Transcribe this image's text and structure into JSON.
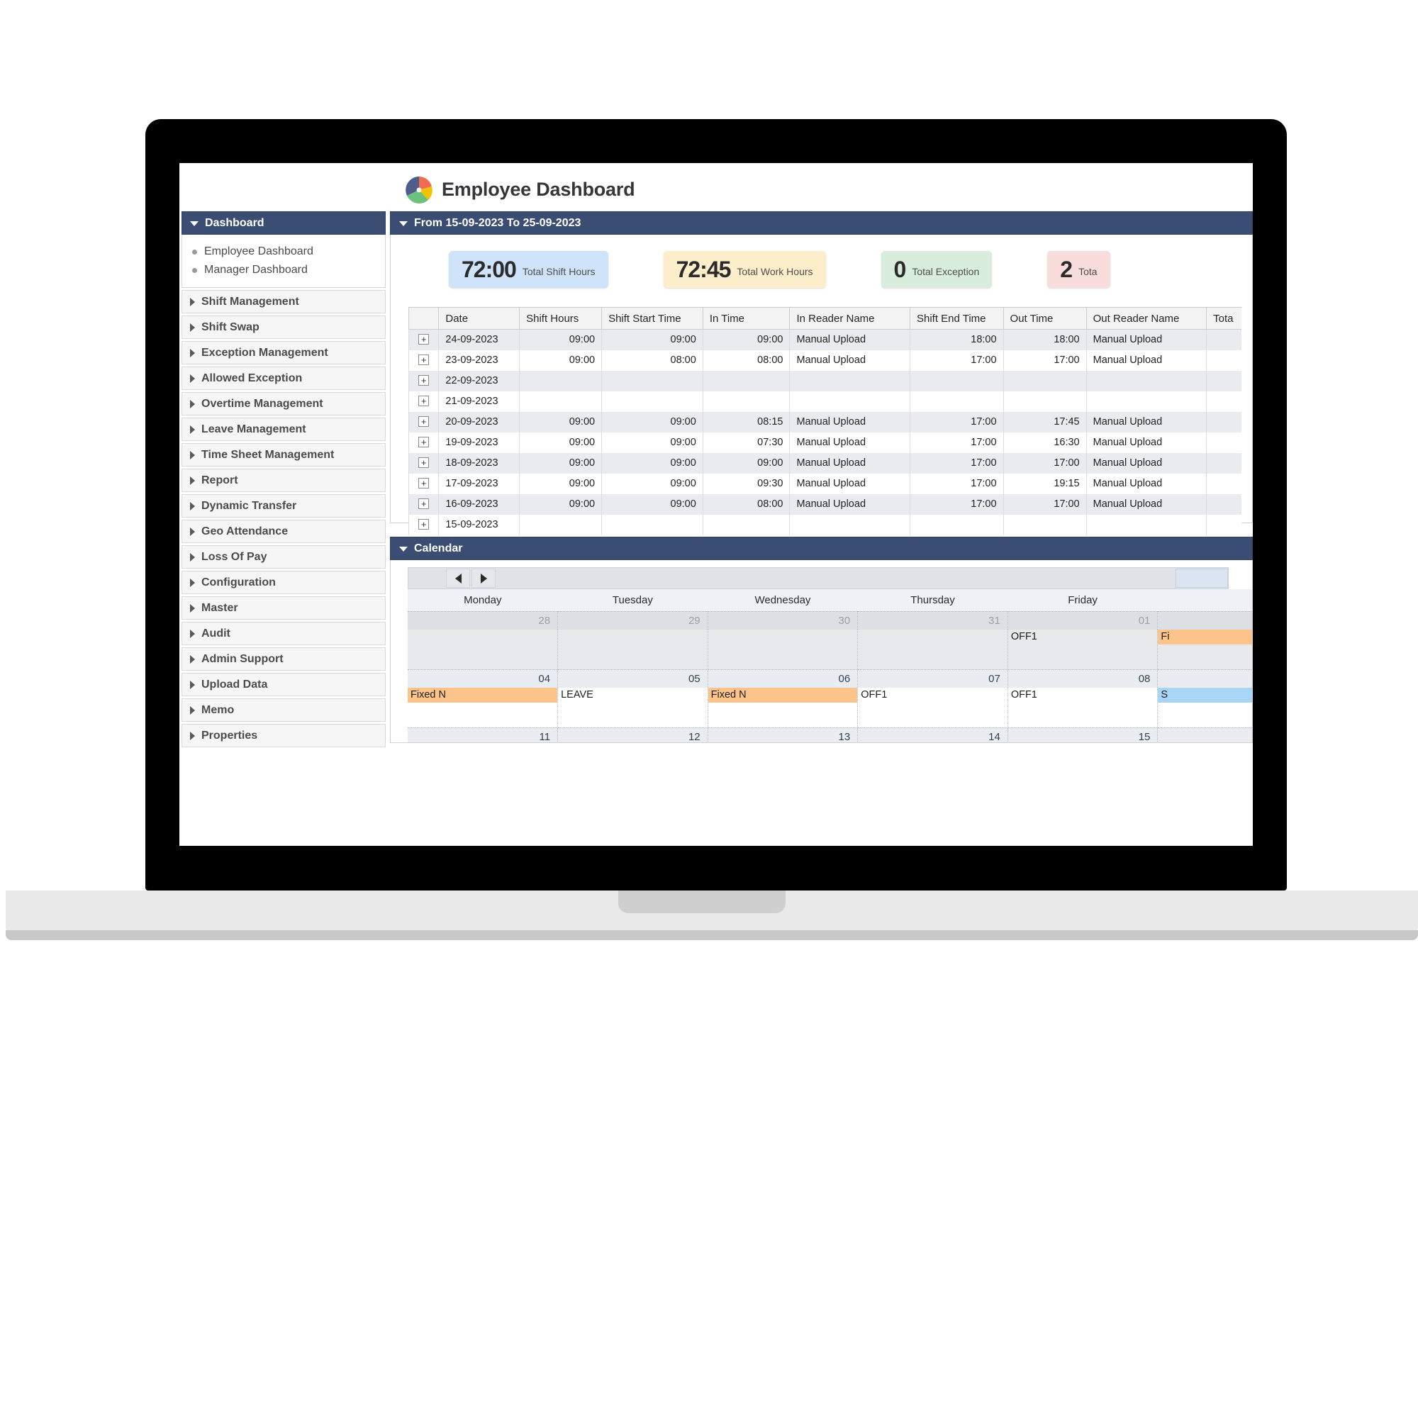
{
  "app": {
    "title": "Employee Dashboard",
    "logo_icon": "pie-chart-icon"
  },
  "sidebar": {
    "header": {
      "label": "Dashboard",
      "icon": "caret-down-icon"
    },
    "sub_items": [
      {
        "label": "Employee Dashboard",
        "icon": "bullet-icon"
      },
      {
        "label": "Manager Dashboard",
        "icon": "bullet-icon"
      }
    ],
    "items": [
      {
        "label": "Shift Management",
        "icon": "caret-right-icon"
      },
      {
        "label": "Shift Swap",
        "icon": "caret-right-icon"
      },
      {
        "label": "Exception Management",
        "icon": "caret-right-icon"
      },
      {
        "label": "Allowed Exception",
        "icon": "caret-right-icon"
      },
      {
        "label": "Overtime Management",
        "icon": "caret-right-icon"
      },
      {
        "label": "Leave Management",
        "icon": "caret-right-icon"
      },
      {
        "label": "Time Sheet Management",
        "icon": "caret-right-icon"
      },
      {
        "label": "Report",
        "icon": "caret-right-icon"
      },
      {
        "label": "Dynamic Transfer",
        "icon": "caret-right-icon"
      },
      {
        "label": "Geo Attendance",
        "icon": "caret-right-icon"
      },
      {
        "label": "Loss Of Pay",
        "icon": "caret-right-icon"
      },
      {
        "label": "Configuration",
        "icon": "caret-right-icon"
      },
      {
        "label": "Master",
        "icon": "caret-right-icon"
      },
      {
        "label": "Audit",
        "icon": "caret-right-icon"
      },
      {
        "label": "Admin Support",
        "icon": "caret-right-icon"
      },
      {
        "label": "Upload Data",
        "icon": "caret-right-icon"
      },
      {
        "label": "Memo",
        "icon": "caret-right-icon"
      },
      {
        "label": "Properties",
        "icon": "caret-right-icon"
      }
    ]
  },
  "summary_panel": {
    "header": "From 15-09-2023 To 25-09-2023",
    "header_icon": "caret-down-icon",
    "stat_cards": [
      {
        "value": "72:00",
        "label": "Total Shift Hours",
        "color": "#cfe3fb"
      },
      {
        "value": "72:45",
        "label": "Total Work Hours",
        "color": "#fceeca"
      },
      {
        "value": "0",
        "label": "Total Exception",
        "color": "#d8eddb"
      },
      {
        "value": "2",
        "label": "Tota",
        "color": "#f9dcdc"
      }
    ],
    "table": {
      "columns": [
        "",
        "Date",
        "Shift Hours",
        "Shift Start Time",
        "In Time",
        "In Reader Name",
        "Shift End Time",
        "Out Time",
        "Out Reader Name",
        "Tota"
      ],
      "expand_icon": "plus-box-icon",
      "rows": [
        {
          "date": "24-09-2023",
          "shift_hours": "09:00",
          "shift_start": "09:00",
          "in_time": "09:00",
          "in_reader": "Manual Upload",
          "shift_end": "18:00",
          "out_time": "18:00",
          "out_reader": "Manual Upload",
          "total": ""
        },
        {
          "date": "23-09-2023",
          "shift_hours": "09:00",
          "shift_start": "08:00",
          "in_time": "08:00",
          "in_reader": "Manual Upload",
          "shift_end": "17:00",
          "out_time": "17:00",
          "out_reader": "Manual Upload",
          "total": ""
        },
        {
          "date": "22-09-2023",
          "shift_hours": "",
          "shift_start": "",
          "in_time": "",
          "in_reader": "",
          "shift_end": "",
          "out_time": "",
          "out_reader": "",
          "total": ""
        },
        {
          "date": "21-09-2023",
          "shift_hours": "",
          "shift_start": "",
          "in_time": "",
          "in_reader": "",
          "shift_end": "",
          "out_time": "",
          "out_reader": "",
          "total": ""
        },
        {
          "date": "20-09-2023",
          "shift_hours": "09:00",
          "shift_start": "09:00",
          "in_time": "08:15",
          "in_reader": "Manual Upload",
          "shift_end": "17:00",
          "out_time": "17:45",
          "out_reader": "Manual Upload",
          "total": ""
        },
        {
          "date": "19-09-2023",
          "shift_hours": "09:00",
          "shift_start": "09:00",
          "in_time": "07:30",
          "in_reader": "Manual Upload",
          "shift_end": "17:00",
          "out_time": "16:30",
          "out_reader": "Manual Upload",
          "total": ""
        },
        {
          "date": "18-09-2023",
          "shift_hours": "09:00",
          "shift_start": "09:00",
          "in_time": "09:00",
          "in_reader": "Manual Upload",
          "shift_end": "17:00",
          "out_time": "17:00",
          "out_reader": "Manual Upload",
          "total": ""
        },
        {
          "date": "17-09-2023",
          "shift_hours": "09:00",
          "shift_start": "09:00",
          "in_time": "09:30",
          "in_reader": "Manual Upload",
          "shift_end": "17:00",
          "out_time": "19:15",
          "out_reader": "Manual Upload",
          "total": ""
        },
        {
          "date": "16-09-2023",
          "shift_hours": "09:00",
          "shift_start": "09:00",
          "in_time": "08:00",
          "in_reader": "Manual Upload",
          "shift_end": "17:00",
          "out_time": "17:00",
          "out_reader": "Manual Upload",
          "total": ""
        },
        {
          "date": "15-09-2023",
          "shift_hours": "",
          "shift_start": "",
          "in_time": "",
          "in_reader": "",
          "shift_end": "",
          "out_time": "",
          "out_reader": "",
          "total": ""
        }
      ]
    }
  },
  "calendar": {
    "header": "Calendar",
    "header_icon": "caret-down-icon",
    "prev_icon": "triangle-left-icon",
    "next_icon": "triangle-right-icon",
    "day_headers": [
      "Monday",
      "Tuesday",
      "Wednesday",
      "Thursday",
      "Friday",
      ""
    ],
    "weeks": [
      {
        "type": "other",
        "days": [
          {
            "date": "28",
            "events": []
          },
          {
            "date": "29",
            "events": []
          },
          {
            "date": "30",
            "events": []
          },
          {
            "date": "31",
            "events": []
          },
          {
            "date": "01",
            "events": [
              {
                "label": "OFF1",
                "style": "plain"
              }
            ]
          },
          {
            "date": "",
            "events": [
              {
                "label": "Fi",
                "style": "orange"
              }
            ]
          }
        ]
      },
      {
        "type": "current",
        "days": [
          {
            "date": "04",
            "events": [
              {
                "label": "Fixed  N",
                "style": "orange"
              }
            ]
          },
          {
            "date": "05",
            "events": [
              {
                "label": "LEAVE",
                "style": "plain"
              }
            ]
          },
          {
            "date": "06",
            "events": [
              {
                "label": "Fixed  N",
                "style": "orange"
              }
            ]
          },
          {
            "date": "07",
            "events": [
              {
                "label": "OFF1",
                "style": "plain"
              }
            ]
          },
          {
            "date": "08",
            "events": [
              {
                "label": "OFF1",
                "style": "plain"
              }
            ]
          },
          {
            "date": "",
            "events": [
              {
                "label": "S",
                "style": "blue"
              }
            ]
          }
        ]
      },
      {
        "type": "current",
        "days": [
          {
            "date": "11",
            "events": [
              {
                "label": "",
                "style": "bar"
              }
            ]
          },
          {
            "date": "12",
            "events": [
              {
                "label": "",
                "style": "bar"
              }
            ]
          },
          {
            "date": "13",
            "events": [
              {
                "label": "",
                "style": "bar"
              }
            ]
          },
          {
            "date": "14",
            "events": []
          },
          {
            "date": "15",
            "events": []
          },
          {
            "date": "",
            "events": []
          }
        ]
      }
    ]
  }
}
